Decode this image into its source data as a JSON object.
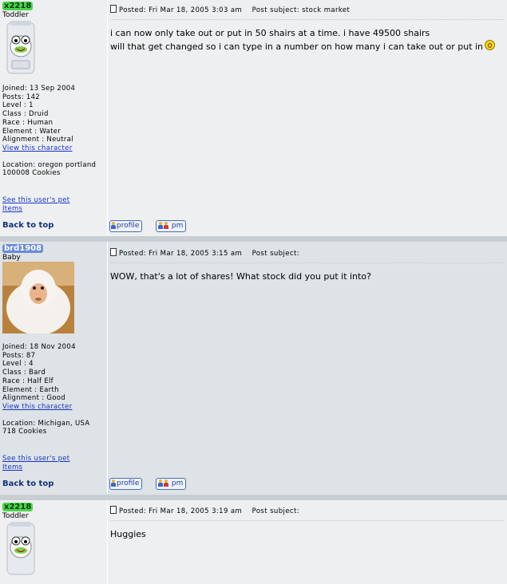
{
  "posts": [
    {
      "username": "x2218",
      "rank": "Toddler",
      "avatar_icon": "baby-diaper-frog-avatar",
      "info_lines": [
        "Joined: 13 Sep 2004",
        "Posts: 142",
        "Level : 1",
        "Class : Druid",
        "Race : Human",
        "Element : Water",
        "Alignment : Neutral"
      ],
      "view_character": "View this character",
      "location_lines": [
        "Location: oregon portland",
        "100008 Cookies"
      ],
      "see_pet": "See this user's pet",
      "items": "Items",
      "posted": "Posted: Fri Mar 18, 2005 3:03 am",
      "subject": "Post subject: stock market",
      "message_lines": [
        "i can now only take out or put in 50 shairs at a time. i have 49500 shairs",
        "will that get changed so i can type in a number on how many i can take out or put in"
      ],
      "back_to_top": "Back to top",
      "profile_label": "profile",
      "pm_label": "pm"
    },
    {
      "username": "brd1908",
      "rank": "Baby",
      "avatar_icon": "white-monkey-avatar",
      "info_lines": [
        "Joined: 18 Nov 2004",
        "Posts: 87",
        "Level : 4",
        "Class : Bard",
        "Race : Half Elf",
        "Element : Earth",
        "Alignment : Good"
      ],
      "view_character": "View this character",
      "location_lines": [
        "Location: Michigan, USA",
        "718 Cookies"
      ],
      "see_pet": "See this user's pet",
      "items": "Items",
      "posted": "Posted: Fri Mar 18, 2005 3:15 am",
      "subject": "Post subject:",
      "message_lines": [
        "WOW, that's a lot of shares! What stock did you put it into?"
      ],
      "back_to_top": "Back to top",
      "profile_label": "profile",
      "pm_label": "pm"
    },
    {
      "username": "x2218",
      "rank": "Toddler",
      "avatar_icon": "baby-diaper-frog-avatar",
      "posted": "Posted: Fri Mar 18, 2005 3:19 am",
      "subject": "Post subject:",
      "message_lines": [
        "Huggies"
      ]
    }
  ],
  "colors": {
    "row_light": "#eeeff0",
    "row_dark": "#dde3e6",
    "separator": "#c8ced2",
    "link": "#1533c8",
    "username_green": "#4ad34a",
    "username_blue": "#6a8ad8"
  }
}
